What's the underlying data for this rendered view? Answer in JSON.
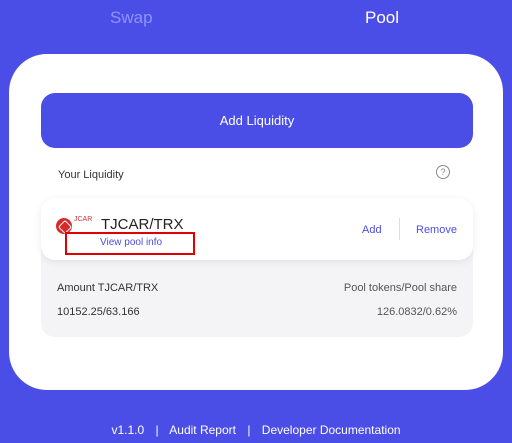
{
  "tabs": {
    "swap": "Swap",
    "pool": "Pool"
  },
  "card": {
    "add_liquidity": "Add Liquidity",
    "your_liquidity": "Your Liquidity",
    "help_icon": "?"
  },
  "position": {
    "token_logo_text": "JCAR",
    "pair": "TJCAR/TRX",
    "view_pool_info": "View pool info",
    "add": "Add",
    "remove": "Remove",
    "amount_label": "Amount TJCAR/TRX",
    "amount_value": "10152.25/63.166",
    "share_label": "Pool tokens/Pool share",
    "share_value": "126.0832/0.62%"
  },
  "footer": {
    "version": "v1.1.0",
    "audit": "Audit Report",
    "docs": "Developer Documentation",
    "separator": "|"
  },
  "colors": {
    "primary": "#4b4ee6",
    "highlight": "#e00000",
    "token": "#d62b2b"
  }
}
